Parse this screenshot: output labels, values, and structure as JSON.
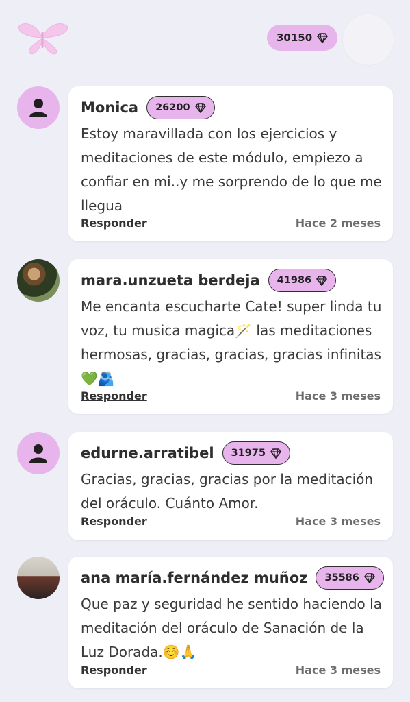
{
  "header": {
    "points": "30150"
  },
  "comments": [
    {
      "name": "Monica",
      "points": "26200",
      "text": "Estoy maravillada con los ejercicios y meditaciones de este módulo,  empiezo a confiar en mi..y me sorprendo de lo que me llegua",
      "reply_label": "Responder",
      "time": "Hace 2 meses",
      "avatar_type": "default"
    },
    {
      "name": "mara.unzueta berdeja",
      "points": "41986",
      "text": "Me encanta escucharte Cate! super linda tu voz, tu musica magica🪄 las meditaciones hermosas, gracias, gracias, gracias infinitas💚🫂",
      "reply_label": "Responder",
      "time": "Hace 3 meses",
      "avatar_type": "photo"
    },
    {
      "name": "edurne.arratibel",
      "points": "31975",
      "text": "Gracias, gracias, gracias por la meditación del oráculo. Cuánto Amor.",
      "reply_label": "Responder",
      "time": "Hace 3 meses",
      "avatar_type": "default"
    },
    {
      "name": "ana maría.fernández muñoz",
      "points": "35586",
      "text": "Que paz y seguridad he sentido haciendo la meditación del oráculo de Sanación de la Luz Dorada.☺️🙏",
      "reply_label": "Responder",
      "time": "Hace 3 meses",
      "avatar_type": "photo"
    }
  ],
  "colors": {
    "badge": "#e7b4ec",
    "background": "#eeeef6",
    "card": "#ffffff"
  },
  "icons": {
    "gem": "diamond-icon",
    "user": "user-silhouette-icon"
  }
}
